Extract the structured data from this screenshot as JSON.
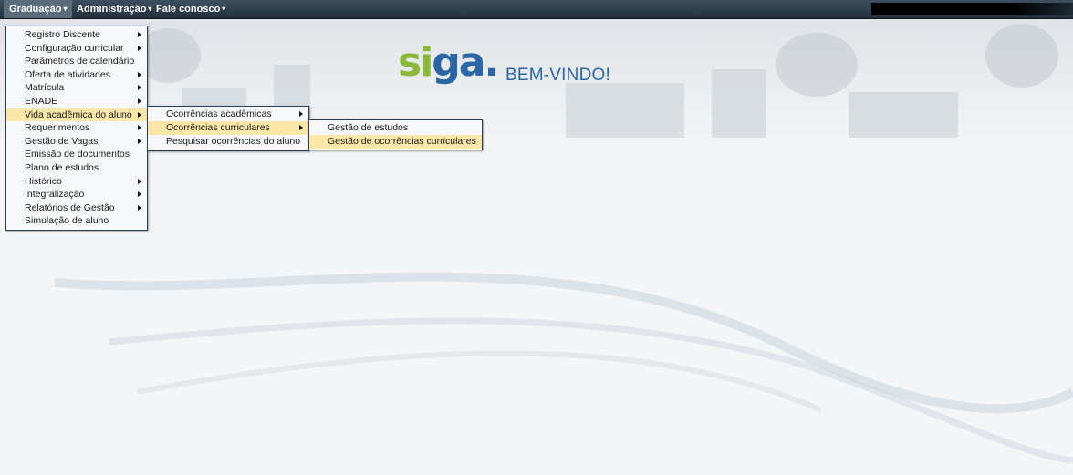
{
  "menubar": {
    "items": [
      {
        "label": "Graduação",
        "active": true
      },
      {
        "label": "Administração",
        "active": false
      },
      {
        "label": "Fale conosco",
        "active": false
      }
    ],
    "caret": "▾"
  },
  "header": {
    "logo": {
      "part1": "si",
      "part2": "ga",
      "dot": "."
    },
    "welcome": "BEM-VINDO!"
  },
  "menu_graduacao": {
    "items": [
      {
        "label": "Registro Discente",
        "submenu": true
      },
      {
        "label": "Configuração curricular",
        "submenu": true
      },
      {
        "label": "Parâmetros de calendário",
        "submenu": false
      },
      {
        "label": "Oferta de atividades",
        "submenu": true
      },
      {
        "label": "Matrícula",
        "submenu": true
      },
      {
        "label": "ENADE",
        "submenu": true
      },
      {
        "label": "Vida acadêmica do aluno",
        "submenu": true,
        "highlighted": true
      },
      {
        "label": "Requerimentos",
        "submenu": true
      },
      {
        "label": "Gestão de Vagas",
        "submenu": true
      },
      {
        "label": "Emissão de documentos",
        "submenu": false
      },
      {
        "label": "Plano de estudos",
        "submenu": false
      },
      {
        "label": "Histórico",
        "submenu": true
      },
      {
        "label": "Integralização",
        "submenu": true
      },
      {
        "label": "Relatórios de Gestão",
        "submenu": true
      },
      {
        "label": "Simulação de aluno",
        "submenu": false
      }
    ]
  },
  "menu_vida_academica": {
    "items": [
      {
        "label": "Ocorrências acadêmicas",
        "submenu": true
      },
      {
        "label": "Ocorrências curriculares",
        "submenu": true,
        "highlighted": true
      },
      {
        "label": "Pesquisar ocorrências do aluno",
        "submenu": false
      }
    ]
  },
  "menu_ocorrencias_curriculares": {
    "items": [
      {
        "label": "Gestão de estudos",
        "submenu": false
      },
      {
        "label": "Gestão de ocorrências curriculares",
        "submenu": false,
        "highlighted": true
      }
    ]
  },
  "colors": {
    "menubar": "#22303c",
    "highlight": "#fbe7a8",
    "logo_green": "#8ab93a",
    "logo_blue": "#2a66a5"
  }
}
